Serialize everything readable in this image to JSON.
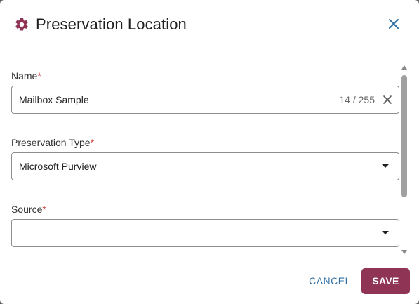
{
  "dialog": {
    "title": "Preservation Location",
    "title_icon": "gear-icon",
    "close_icon": "close-icon"
  },
  "fields": {
    "name": {
      "label": "Name",
      "required_mark": "*",
      "value": "Mailbox Sample",
      "counter": "14 / 255"
    },
    "preservation_type": {
      "label": "Preservation Type",
      "required_mark": "*",
      "value": "Microsoft Purview"
    },
    "source": {
      "label": "Source",
      "required_mark": "*",
      "value": ""
    }
  },
  "actions": {
    "cancel_label": "CANCEL",
    "save_label": "SAVE"
  },
  "colors": {
    "accent": "#8f3455",
    "link": "#2f6fa3",
    "required": "#d64545"
  }
}
